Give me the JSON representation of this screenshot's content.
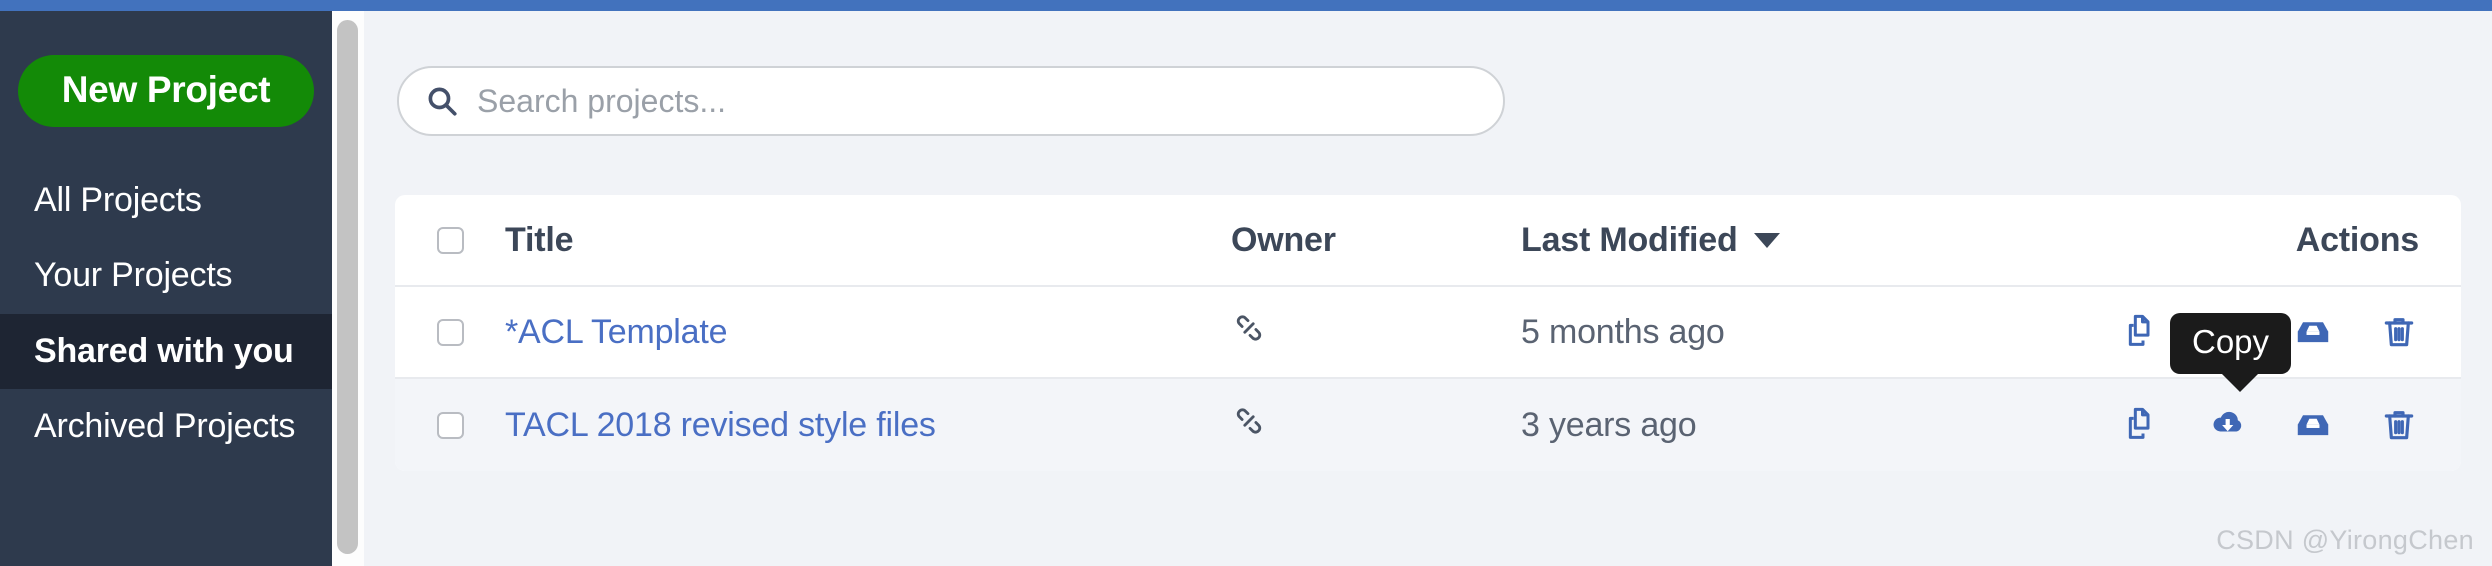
{
  "theme": {
    "topbar_color": "#4272bd",
    "sidebar_bg": "#2e3a4d",
    "sidebar_active_bg": "#1e2533",
    "new_project_green": "#138a07",
    "link_blue": "#4a6fc4",
    "icon_blue": "#4a72bf",
    "page_bg": "#f1f3f7",
    "tooltip_bg": "#1b1b1b"
  },
  "sidebar": {
    "new_project_label": "New Project",
    "items": [
      {
        "label": "All Projects",
        "active": false
      },
      {
        "label": "Your Projects",
        "active": false
      },
      {
        "label": "Shared with you",
        "active": true
      },
      {
        "label": "Archived Projects",
        "active": false
      }
    ]
  },
  "search": {
    "placeholder": "Search projects...",
    "value": "",
    "icon": "search-icon"
  },
  "table": {
    "columns": {
      "select": "",
      "title": "Title",
      "owner": "Owner",
      "last_modified": "Last Modified",
      "actions": "Actions"
    },
    "sort": {
      "column": "Last Modified",
      "direction": "desc",
      "caret": "chevron-down-icon"
    },
    "rows": [
      {
        "selected": false,
        "title": "*ACL Template",
        "owner_icon": "link-icon",
        "owner": "",
        "last_modified": "5 months ago",
        "actions": [
          "copy",
          "download",
          "archive",
          "delete"
        ]
      },
      {
        "selected": false,
        "title": "TACL 2018 revised style files",
        "owner_icon": "link-icon",
        "owner": "",
        "last_modified": "3 years ago",
        "actions": [
          "copy",
          "download",
          "archive",
          "delete"
        ]
      }
    ]
  },
  "actions_labels": {
    "copy": "Copy",
    "download": "Download",
    "archive": "Archive",
    "delete": "Delete"
  },
  "tooltip": {
    "text": "Copy",
    "target_row": 0,
    "target_action": "copy"
  },
  "watermark": {
    "text": "CSDN @YirongChen"
  }
}
